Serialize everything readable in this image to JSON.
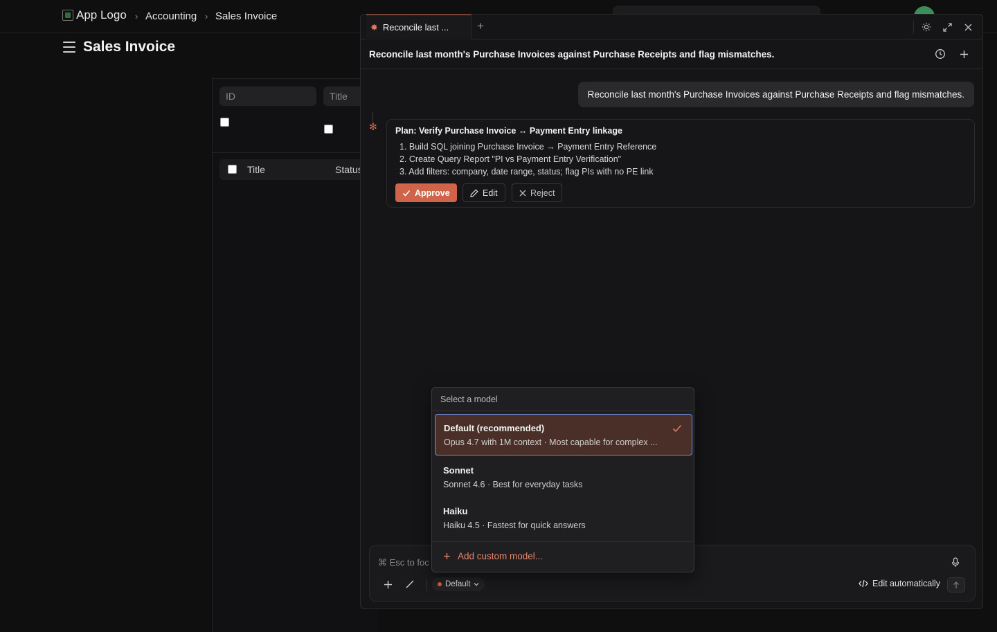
{
  "app": {
    "logo_alt": "App Logo",
    "breadcrumbs": [
      "Accounting",
      "Sales Invoice"
    ],
    "page_title": "Sales Invoice"
  },
  "list": {
    "filters": [
      {
        "placeholder": "ID"
      },
      {
        "placeholder": "Title"
      }
    ],
    "columns": [
      "Title",
      "Status"
    ]
  },
  "assistant": {
    "tab_label": "Reconcile last ...",
    "conversation_title": "Reconcile last month's Purchase Invoices against Purchase Receipts and flag mismatches.",
    "user_message": "Reconcile last month's Purchase Invoices against Purchase Receipts and flag mismatches.",
    "plan": {
      "title": "Plan: Verify Purchase Invoice ↔ Payment Entry linkage",
      "steps": [
        "1. Build SQL joining Purchase Invoice → Payment Entry Reference",
        "2. Create Query Report \"PI vs Payment Entry Verification\"",
        "3. Add filters: company, date range, status; flag PIs with no PE link"
      ],
      "approve_label": "Approve",
      "edit_label": "Edit",
      "reject_label": "Reject"
    },
    "composer": {
      "placeholder": "⌘ Esc to foc",
      "model_chip": "Default",
      "edit_auto_label": "Edit automatically"
    }
  },
  "model_menu": {
    "title": "Select a model",
    "options": [
      {
        "name": "Default (recommended)",
        "description": "Opus 4.7 with 1M context · Most capable for complex ...",
        "selected": true
      },
      {
        "name": "Sonnet",
        "description": "Sonnet 4.6 · Best for everyday tasks",
        "selected": false
      },
      {
        "name": "Haiku",
        "description": "Haiku 4.5 · Fastest for quick answers",
        "selected": false
      }
    ],
    "add_custom_label": "Add custom model..."
  },
  "colors": {
    "accent": "#d0644a",
    "selected_bg": "#4a2f29",
    "focus_ring": "#6f8fe8"
  }
}
